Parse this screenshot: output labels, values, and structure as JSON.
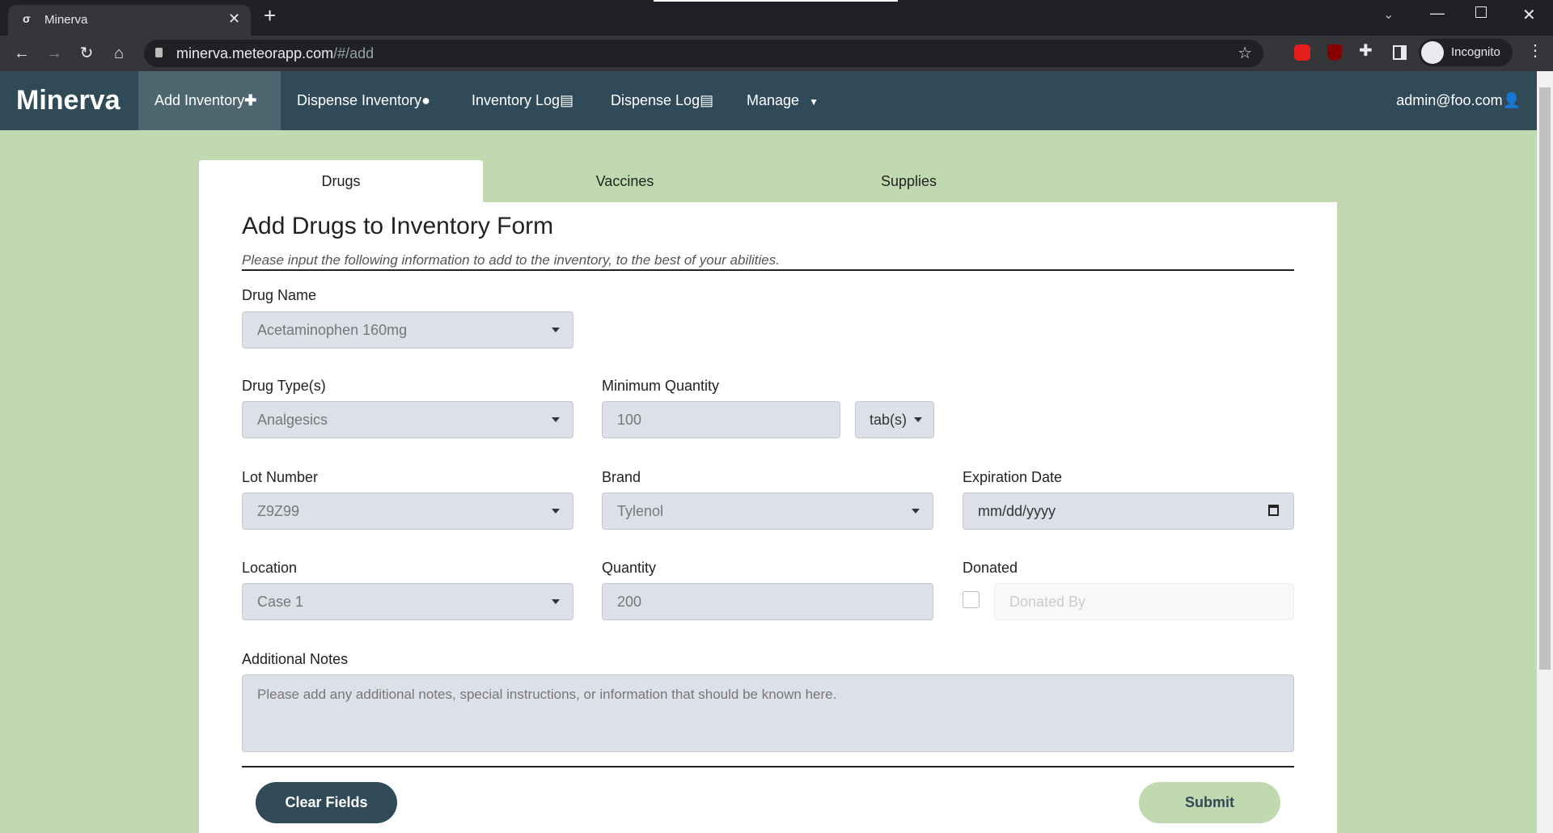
{
  "browser": {
    "tab_title": "Minerva",
    "url_host": "minerva.meteorapp.com",
    "url_path": "/#/add",
    "profile": "Incognito"
  },
  "nav": {
    "logo": "Minerva",
    "items": [
      {
        "label": "Add Inventory"
      },
      {
        "label": "Dispense Inventory"
      },
      {
        "label": "Inventory Log"
      },
      {
        "label": "Dispense Log"
      },
      {
        "label": "Manage"
      }
    ],
    "user": "admin@foo.com"
  },
  "tabs": [
    "Drugs",
    "Vaccines",
    "Supplies"
  ],
  "form": {
    "title": "Add Drugs to Inventory Form",
    "subtitle": "Please input the following information to add to the inventory, to the best of your abilities.",
    "drug_name": {
      "label": "Drug Name",
      "value": "Acetaminophen 160mg"
    },
    "drug_type": {
      "label": "Drug Type(s)",
      "value": "Analgesics"
    },
    "min_qty": {
      "label": "Minimum Quantity",
      "value": "100",
      "unit": "tab(s)"
    },
    "lot": {
      "label": "Lot Number",
      "value": "Z9Z99"
    },
    "brand": {
      "label": "Brand",
      "value": "Tylenol"
    },
    "expiration": {
      "label": "Expiration Date",
      "placeholder": "mm/dd/yyyy"
    },
    "location": {
      "label": "Location",
      "value": "Case 1"
    },
    "quantity": {
      "label": "Quantity",
      "value": "200"
    },
    "donated": {
      "label": "Donated",
      "placeholder": "Donated By"
    },
    "notes": {
      "label": "Additional Notes",
      "placeholder": "Please add any additional notes, special instructions, or information that should be known here."
    },
    "clear_label": "Clear Fields",
    "submit_label": "Submit"
  }
}
